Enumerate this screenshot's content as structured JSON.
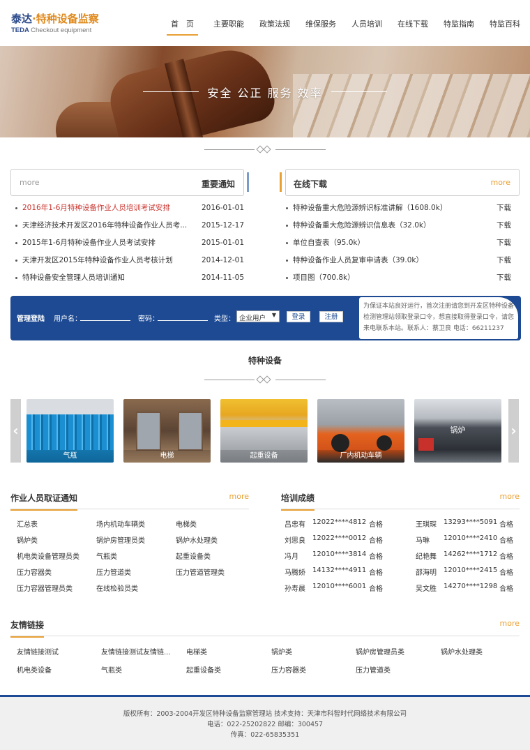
{
  "logo": {
    "cn_name": "泰达",
    "cn_dot": "·",
    "cn_sub": "特种设备监察",
    "en1": "TEDA",
    "en2": "Checkout equipment"
  },
  "nav": [
    "首　页",
    "主要职能",
    "政策法规",
    "维保服务",
    "人员培训",
    "在线下载",
    "特监指南",
    "特监百科"
  ],
  "banner": {
    "slogan": "安全 公正 服务 效率"
  },
  "notice": {
    "more": "more",
    "title": "重要通知",
    "items": [
      {
        "text": "2016年1-6月特种设备作业人员培训考试安排",
        "date": "2016-01-01",
        "hot": true
      },
      {
        "text": "天津经济技术开发区2016年特种设备作业人员考...",
        "date": "2015-12-17",
        "hot": false
      },
      {
        "text": "2015年1-6月特种设备作业人员考试安排",
        "date": "2015-01-01",
        "hot": false
      },
      {
        "text": "天津开发区2015年特种设备作业人员考核计划",
        "date": "2014-12-01",
        "hot": false
      },
      {
        "text": "特种设备安全管理人员培训通知",
        "date": "2014-11-05",
        "hot": false
      }
    ]
  },
  "download": {
    "title": "在线下载",
    "more": "more",
    "action": "下载",
    "items": [
      "特种设备重大危险源辨识标准讲解（1608.0k）",
      "特种设备重大危险源辨识信息表（32.0k）",
      "单位自查表（95.0k）",
      "特种设备作业人员复审申请表（39.0k）",
      "项目图（700.8k）"
    ]
  },
  "login": {
    "title": "管理登陆",
    "user_label": "用户名：",
    "pwd_label": "密码：",
    "type_label": "类型：",
    "type_value": "企业用户",
    "login_btn": "登录",
    "register_btn": "注册",
    "note": "为保证本站良好运行，首次注册请您到开发区特种设备检测管理站领取登录口令，想直接取得登录口令，请您来电联系本站。联系人：蔡卫良 电话：66211237"
  },
  "equipment": {
    "title": "特种设备",
    "items": [
      "气瓶",
      "电梯",
      "起重设备",
      "厂内机动车辆",
      "锅炉"
    ],
    "prev_icon": "‹",
    "next_icon": "›"
  },
  "cert": {
    "title": "作业人员取证通知",
    "more": "more",
    "items": [
      "汇总表",
      "场内机动车辆类",
      "电梯类",
      "锅炉类",
      "锅炉房管理员类",
      "锅炉水处理类",
      "机电类设备管理员类",
      "气瓶类",
      "起重设备类",
      "压力容器类",
      "压力管道类",
      "压力管道管理类",
      "压力容器管理员类",
      "在线检验员类"
    ]
  },
  "training": {
    "title": "培训成绩",
    "more": "more",
    "rows": [
      [
        "吕忠有",
        "12022****4812",
        "合格",
        "王琪琛",
        "13293****5091",
        "合格"
      ],
      [
        "刘思良",
        "12022****0012",
        "合格",
        "马琳",
        "12010****2410",
        "合格"
      ],
      [
        "冯月",
        "12010****3814",
        "合格",
        "纪艳舞",
        "14262****1712",
        "合格"
      ],
      [
        "马腾娇",
        "14132****4911",
        "合格",
        "邵海明",
        "12010****2415",
        "合格"
      ],
      [
        "孙寿晨",
        "12010****6001",
        "合格",
        "吴文胜",
        "14270****1298",
        "合格"
      ]
    ]
  },
  "links": {
    "title": "友情链接",
    "more": "more",
    "items": [
      "友情链接测试",
      "友情链接测试友情链...",
      "电梯类",
      "锅炉类",
      "锅炉房管理员类",
      "锅炉水处理类",
      "机电类设备",
      "气瓶类",
      "起重设备类",
      "压力容器类",
      "压力管道类"
    ]
  },
  "footer": {
    "line1": "版权所有：2003-2004开发区特种设备监察管理站 技术支持：天津市科智时代网络技术有限公司",
    "line2": "电话：022-25202822 邮编：300457",
    "line3": "传真：022-65835351"
  },
  "colors": {
    "accent": "#e8a033",
    "brand_blue": "#1d4a93",
    "hot": "#c8312b"
  }
}
